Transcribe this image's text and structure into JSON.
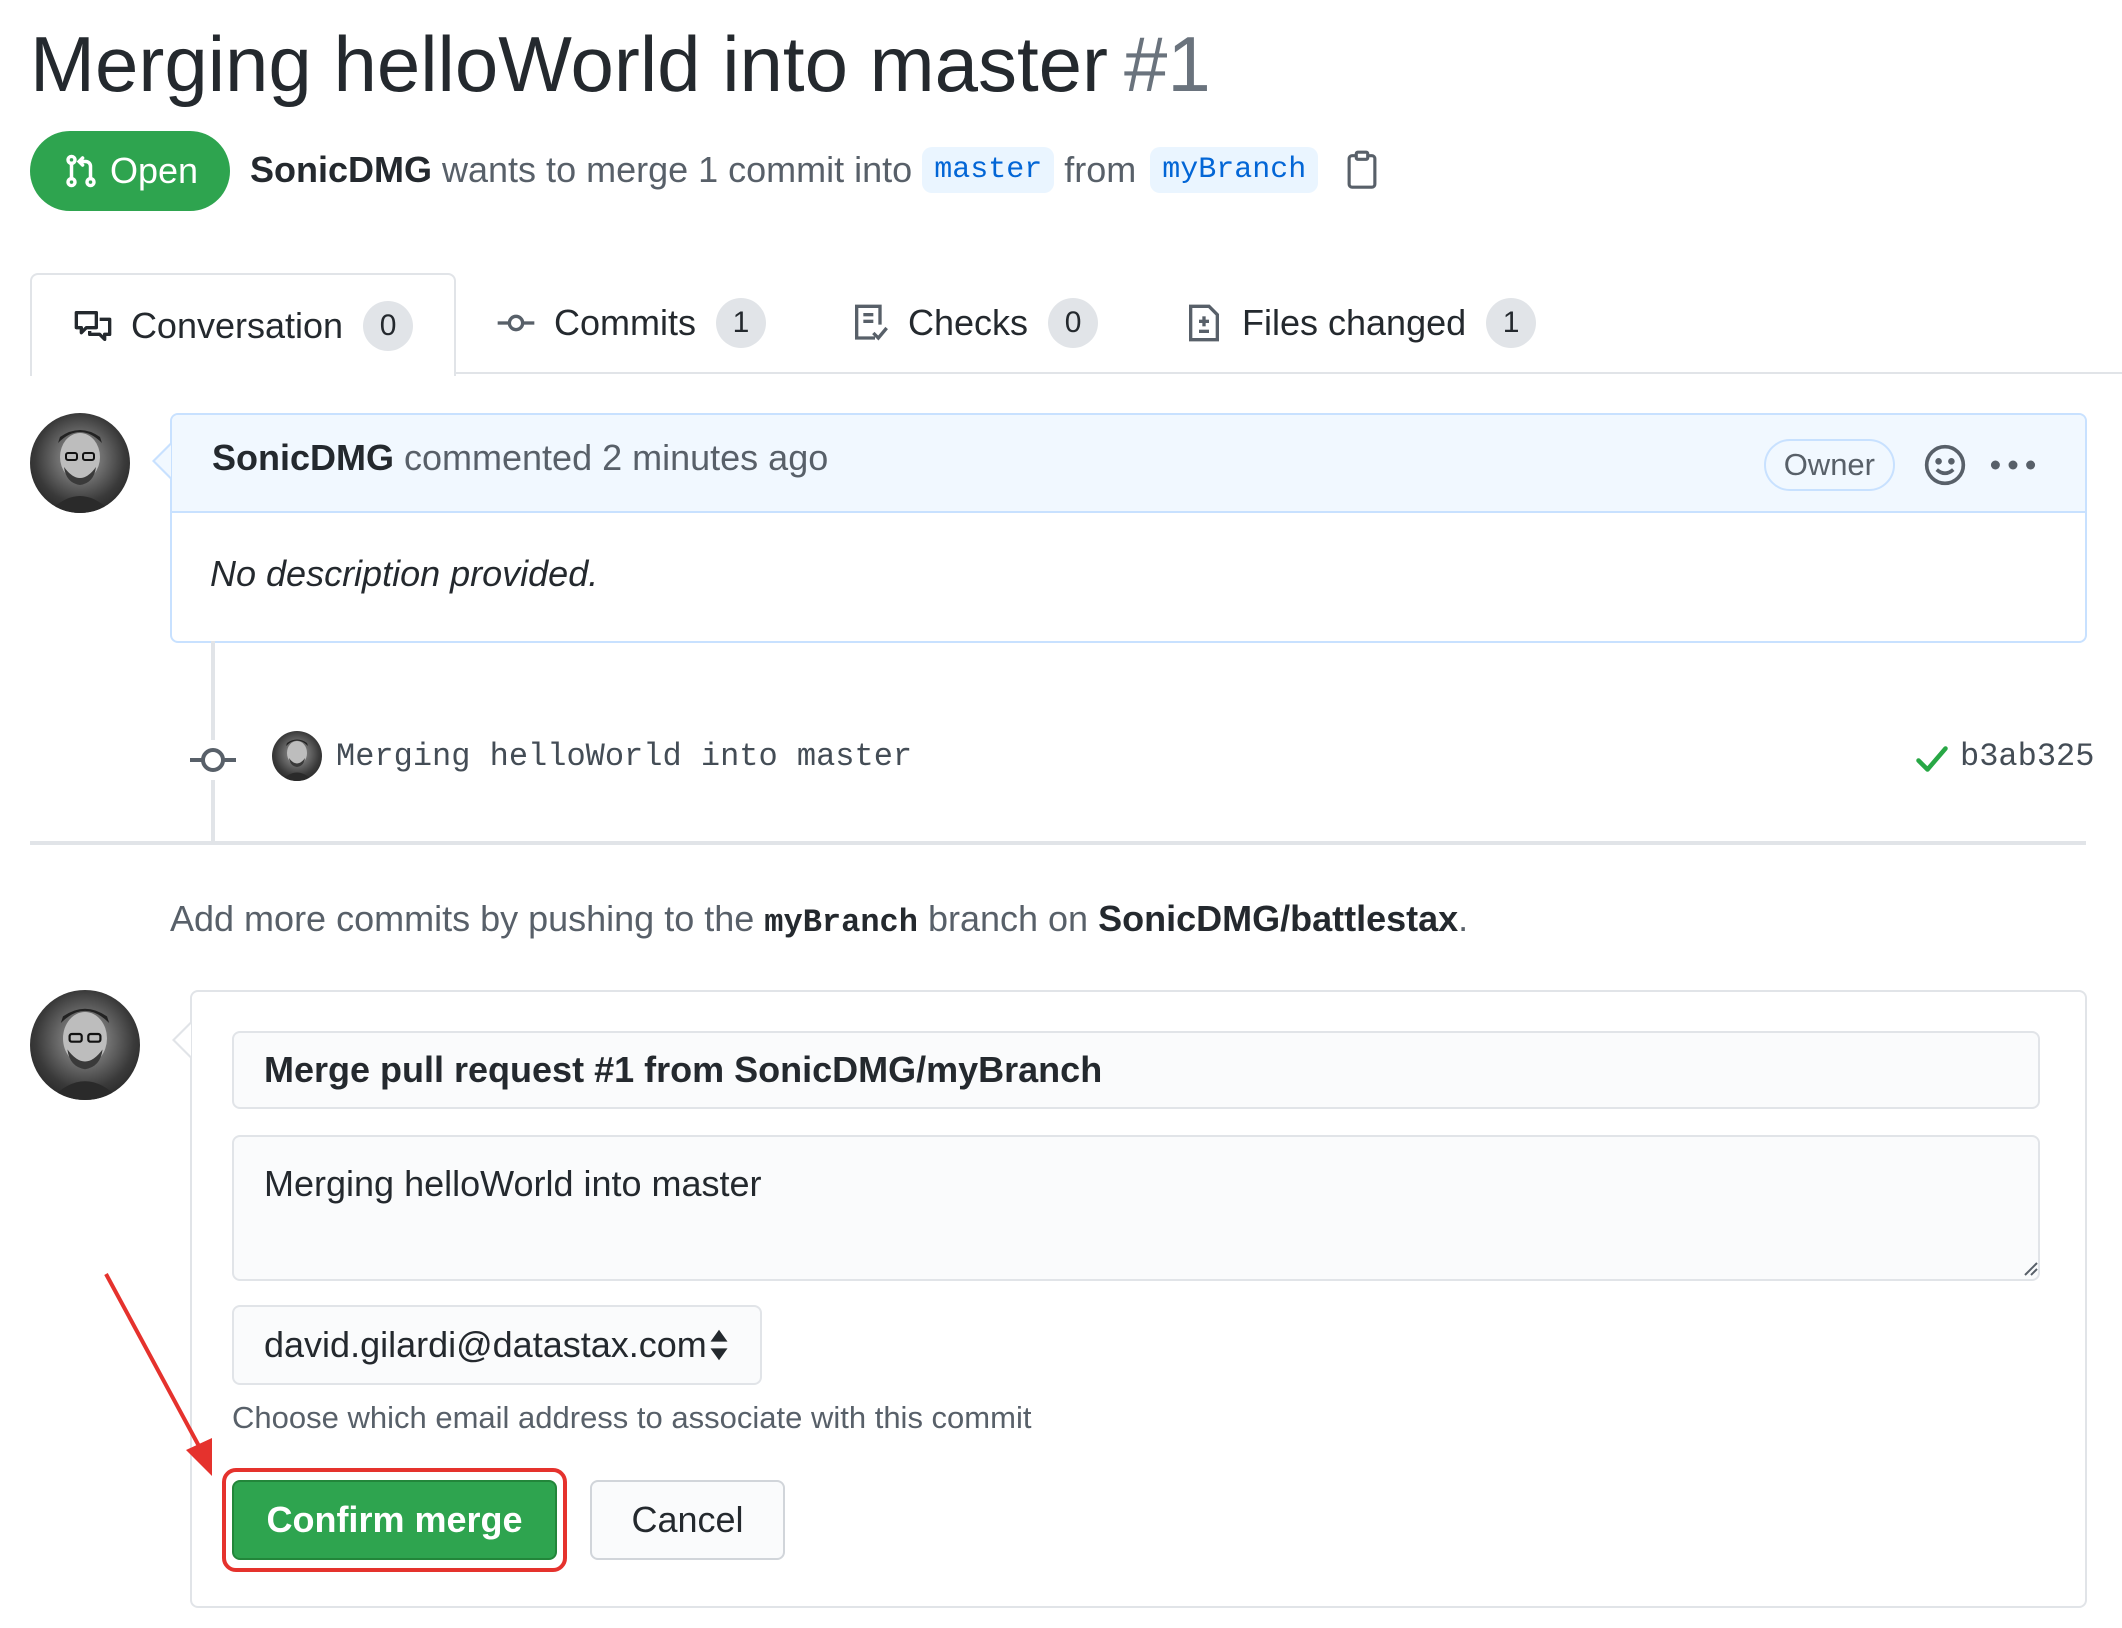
{
  "pr": {
    "title": "Merging helloWorld into master",
    "number": "#1",
    "state": "Open",
    "author": "SonicDMG",
    "summary_text": "wants to merge 1 commit into",
    "base_branch": "master",
    "from_text": "from",
    "head_branch": "myBranch"
  },
  "tabs": [
    {
      "label": "Conversation",
      "count": "0"
    },
    {
      "label": "Commits",
      "count": "1"
    },
    {
      "label": "Checks",
      "count": "0"
    },
    {
      "label": "Files changed",
      "count": "1"
    }
  ],
  "comment": {
    "author": "SonicDMG",
    "meta": "commented 2 minutes ago",
    "role": "Owner",
    "body": "No description provided."
  },
  "commit": {
    "message": "Merging helloWorld into master",
    "sha": "b3ab325",
    "status_color": "#28a745"
  },
  "push_hint": {
    "prefix": "Add more commits by pushing to the",
    "branch": "myBranch",
    "middle": "branch on",
    "repo": "SonicDMG/battlestax",
    "suffix": "."
  },
  "merge": {
    "title_value": "Merge pull request #1 from SonicDMG/myBranch",
    "body_value": "Merging helloWorld into master",
    "email_selected": "david.gilardi@datastax.com",
    "email_help": "Choose which email address to associate with this commit",
    "confirm_label": "Confirm merge",
    "cancel_label": "Cancel"
  },
  "colors": {
    "accent_green": "#2ea44f",
    "link_blue": "#0366d6",
    "highlight_red": "#e5322d"
  }
}
